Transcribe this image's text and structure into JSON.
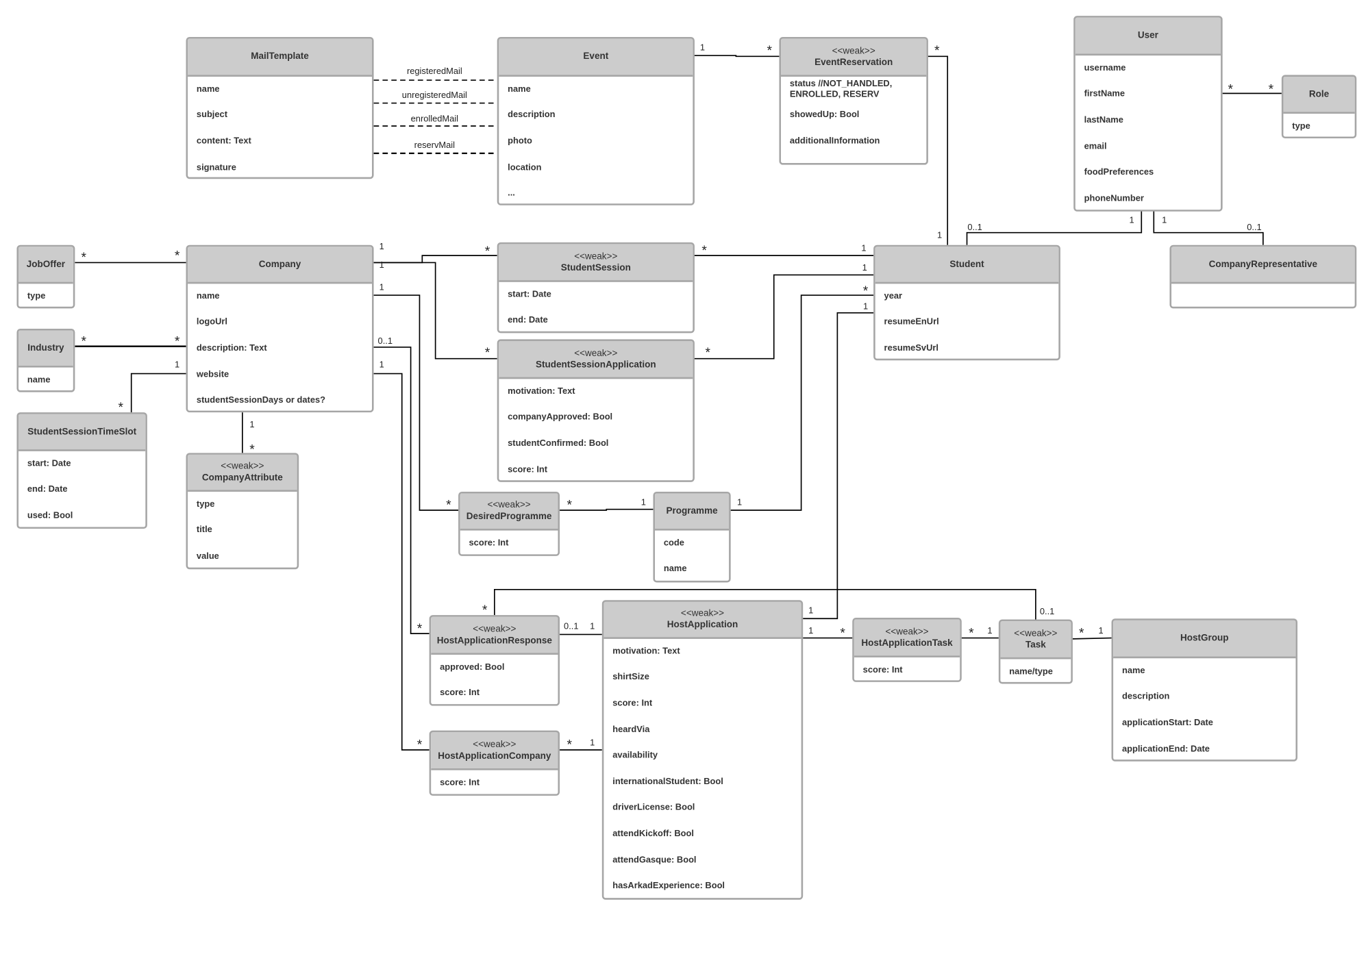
{
  "classes": [
    {
      "id": "MailTemplate",
      "name": "MailTemplate",
      "attributes": [
        "name",
        "subject",
        "content: Text",
        "signature"
      ]
    },
    {
      "id": "Event",
      "name": "Event",
      "attributes": [
        "name",
        "description",
        "photo",
        "location",
        "..."
      ]
    },
    {
      "id": "EventReservation",
      "stereotype": "<<weak>>",
      "name": "EventReservation",
      "attributes": [
        "status //NOT_HANDLED, ENROLLED, RESERV",
        "showedUp: Bool",
        "additionalInformation"
      ]
    },
    {
      "id": "User",
      "name": "User",
      "attributes": [
        "username",
        "firstName",
        "lastName",
        "email",
        "foodPreferences",
        "phoneNumber"
      ]
    },
    {
      "id": "Role",
      "name": "Role",
      "attributes": [
        "type"
      ]
    },
    {
      "id": "JobOffer",
      "name": "JobOffer",
      "attributes": [
        "type"
      ]
    },
    {
      "id": "Company",
      "name": "Company",
      "attributes": [
        "name",
        "logoUrl",
        "description: Text",
        "website",
        "studentSessionDays or dates?"
      ]
    },
    {
      "id": "StudentSession",
      "stereotype": "<<weak>>",
      "name": "StudentSession",
      "attributes": [
        "start: Date",
        "end: Date"
      ]
    },
    {
      "id": "Student",
      "name": "Student",
      "attributes": [
        "year",
        "resumeEnUrl",
        "resumeSvUrl"
      ]
    },
    {
      "id": "CompanyRepresentative",
      "name": "CompanyRepresentative",
      "attributes": []
    },
    {
      "id": "Industry",
      "name": "Industry",
      "attributes": [
        "name"
      ]
    },
    {
      "id": "StudentSessionApplication",
      "stereotype": "<<weak>>",
      "name": "StudentSessionApplication",
      "attributes": [
        "motivation: Text",
        "companyApproved: Bool",
        "studentConfirmed: Bool",
        "score: Int"
      ]
    },
    {
      "id": "StudentSessionTimeSlot",
      "name": "StudentSessionTimeSlot",
      "attributes": [
        "start: Date",
        "end: Date",
        "used: Bool"
      ]
    },
    {
      "id": "CompanyAttribute",
      "stereotype": "<<weak>>",
      "name": "CompanyAttribute",
      "attributes": [
        "type",
        "title",
        "value"
      ]
    },
    {
      "id": "DesiredProgramme",
      "stereotype": "<<weak>>",
      "name": "DesiredProgramme",
      "attributes": [
        "score: Int"
      ]
    },
    {
      "id": "Programme",
      "name": "Programme",
      "attributes": [
        "code",
        "name"
      ]
    },
    {
      "id": "HostApplicationResponse",
      "stereotype": "<<weak>>",
      "name": "HostApplicationResponse",
      "attributes": [
        "approved: Bool",
        "score: Int"
      ]
    },
    {
      "id": "HostApplication",
      "stereotype": "<<weak>>",
      "name": "HostApplication",
      "attributes": [
        "motivation: Text",
        "shirtSize",
        "score:  Int",
        "heardVia",
        "availability",
        "internationalStudent: Bool",
        "driverLicense: Bool",
        "attendKickoff: Bool",
        "attendGasque: Bool",
        "hasArkadExperience: Bool"
      ]
    },
    {
      "id": "HostApplicationTask",
      "stereotype": "<<weak>>",
      "name": "HostApplicationTask",
      "attributes": [
        "score: Int"
      ]
    },
    {
      "id": "Task",
      "stereotype": "<<weak>>",
      "name": "Task",
      "attributes": [
        "name/type"
      ]
    },
    {
      "id": "HostGroup",
      "name": "HostGroup",
      "attributes": [
        "name",
        "description",
        "applicationStart: Date",
        "applicationEnd: Date"
      ]
    },
    {
      "id": "HostApplicationCompany",
      "stereotype": "<<weak>>",
      "name": "HostApplicationCompany",
      "attributes": [
        "score: Int"
      ]
    }
  ],
  "associations": [
    {
      "from": "MailTemplate",
      "to": "Event",
      "name": "registeredMail",
      "labels": [
        "registeredMail"
      ]
    },
    {
      "from": "MailTemplate",
      "to": "Event",
      "name": "unregisteredMail",
      "labels": [
        "unregisteredMail"
      ]
    },
    {
      "from": "MailTemplate",
      "to": "Event",
      "name": "enrolledMail",
      "labels": [
        "enrolledMail"
      ]
    },
    {
      "from": "MailTemplate",
      "to": "Event",
      "name": "reservMail",
      "labels": [
        "reservMail"
      ]
    },
    {
      "from": "Event",
      "to": "EventReservation",
      "labels": [
        "1",
        "*"
      ]
    },
    {
      "from": "EventReservation",
      "to": "Student",
      "labels": [
        "*",
        "1"
      ]
    },
    {
      "from": "User",
      "to": "Role",
      "labels": [
        "*",
        "*"
      ]
    },
    {
      "from": "User",
      "to": "Student",
      "labels": [
        "1",
        "0..1"
      ]
    },
    {
      "from": "User",
      "to": "CompanyRepresentative",
      "labels": [
        "1",
        "0..1"
      ]
    },
    {
      "from": "JobOffer",
      "to": "Company",
      "labels": [
        "*",
        "*"
      ]
    },
    {
      "from": "Industry",
      "to": "Company",
      "labels": [
        "*",
        "*"
      ]
    },
    {
      "from": "Company",
      "to": "StudentSessionTimeSlot",
      "labels": [
        "1",
        "*"
      ]
    },
    {
      "from": "Company",
      "to": "CompanyAttribute",
      "labels": [
        "1",
        "*"
      ]
    },
    {
      "from": "Company",
      "to": "StudentSession",
      "labels": [
        "1",
        "*"
      ]
    },
    {
      "from": "Company",
      "to": "StudentSessionApplication",
      "labels": [
        "1",
        "*"
      ]
    },
    {
      "from": "Company",
      "to": "DesiredProgramme",
      "labels": [
        "1",
        "*"
      ]
    },
    {
      "from": "Company",
      "to": "HostApplicationResponse",
      "labels": [
        "0..1",
        "*"
      ]
    },
    {
      "from": "Company",
      "to": "HostApplicationCompany",
      "labels": [
        "1",
        "*"
      ]
    },
    {
      "from": "StudentSession",
      "to": "Student",
      "labels": [
        "*",
        "1"
      ]
    },
    {
      "from": "StudentSessionApplication",
      "to": "Student",
      "labels": [
        "*",
        "1"
      ]
    },
    {
      "from": "Programme",
      "to": "Student",
      "labels": [
        "1",
        "*"
      ]
    },
    {
      "from": "HostApplication",
      "to": "Student",
      "labels": [
        "1",
        "1"
      ]
    },
    {
      "from": "DesiredProgramme",
      "to": "Programme",
      "labels": [
        "*",
        "1"
      ]
    },
    {
      "from": "HostApplicationResponse",
      "to": "Task",
      "labels": [
        "*",
        "0..1"
      ]
    },
    {
      "from": "HostApplicationResponse",
      "to": "HostApplication",
      "labels": [
        "0..1",
        "1"
      ]
    },
    {
      "from": "HostApplicationCompany",
      "to": "HostApplication",
      "labels": [
        "*",
        "1"
      ]
    },
    {
      "from": "HostApplication",
      "to": "HostApplicationTask",
      "labels": [
        "1",
        "*"
      ]
    },
    {
      "from": "HostApplicationTask",
      "to": "Task",
      "labels": [
        "*",
        "1"
      ]
    },
    {
      "from": "Task",
      "to": "HostGroup",
      "labels": [
        "*",
        "1"
      ]
    }
  ],
  "colors": {
    "header": "#cccccc",
    "border": "#a6a6a6",
    "line": "#000000"
  }
}
